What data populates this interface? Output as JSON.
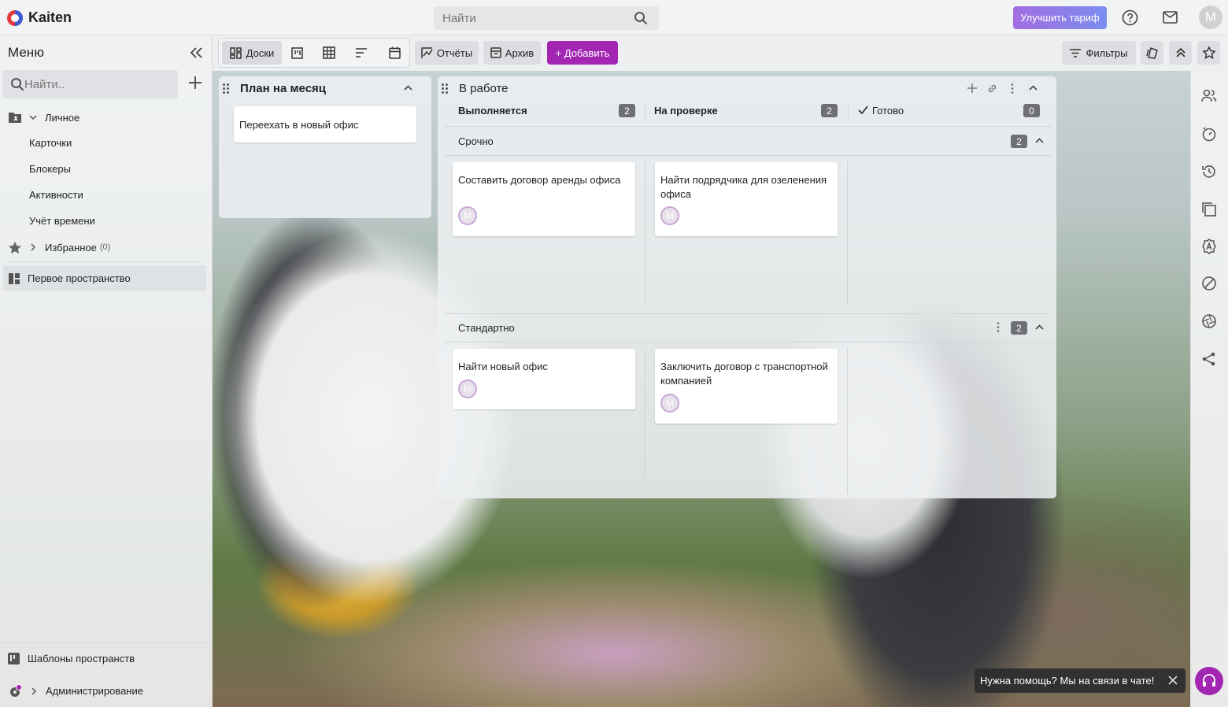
{
  "colors": {
    "accent": "#a326b3",
    "upgrade_start": "#a36ee0",
    "upgrade_end": "#7a8df0",
    "counter": "#6e7074"
  },
  "topbar": {
    "app_title": "Kaiten",
    "search_placeholder": "Найти",
    "upgrade_label": "Улучшить тариф",
    "avatar_letter": "M"
  },
  "sidebar": {
    "menu_title": "Меню",
    "search_placeholder": "Найти..",
    "personal": "Личное",
    "personal_items": [
      "Карточки",
      "Блокеры",
      "Активности",
      "Учёт времени"
    ],
    "favorites": "Избранное",
    "favorites_count": "(0)",
    "space": "Первое пространство",
    "templates": "Шаблоны пространств",
    "admin": "Администрирование"
  },
  "toolbar": {
    "boards": "Доски",
    "reports": "Отчёты",
    "archive": "Архив",
    "add": "+ Добавить",
    "filters": "Фильтры"
  },
  "board": {
    "plan": {
      "title": "План на месяц",
      "cards": [
        "Переехать в новый офис"
      ]
    },
    "work": {
      "title": "В работе",
      "columns": [
        {
          "name": "Выполняется",
          "count": "2"
        },
        {
          "name": "На проверке",
          "count": "2"
        },
        {
          "name": "Готово",
          "count": "0"
        }
      ],
      "lanes": [
        {
          "name": "Срочно",
          "count": "2",
          "cards": [
            "Составить договор аренды офиса",
            "Найти подрядчика для озеленения офиса"
          ]
        },
        {
          "name": "Стандартно",
          "count": "2",
          "cards": [
            "Найти новый офис",
            "Заключить договор с транспортной компанией"
          ]
        }
      ],
      "avatar_letter": "M"
    }
  },
  "help": {
    "text": "Нужна помощь? Мы на связи в чате!"
  }
}
